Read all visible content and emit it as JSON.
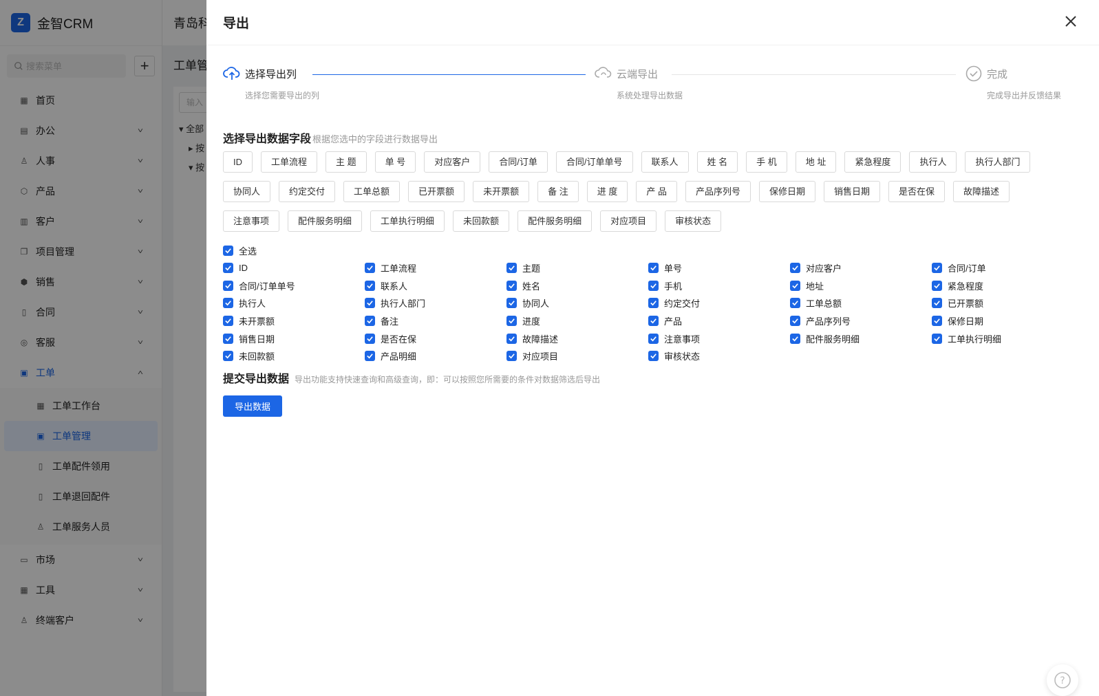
{
  "app": {
    "logo_mark": "Z",
    "name": "金智CRM"
  },
  "sidebar": {
    "search_placeholder": "搜索菜单",
    "add_label": "+",
    "items": [
      {
        "label": "首页",
        "icon": "home-icon"
      },
      {
        "label": "办公",
        "icon": "office-icon"
      },
      {
        "label": "人事",
        "icon": "people-icon"
      },
      {
        "label": "产品",
        "icon": "product-icon"
      },
      {
        "label": "客户",
        "icon": "customer-icon"
      },
      {
        "label": "项目管理",
        "icon": "project-icon"
      },
      {
        "label": "销售",
        "icon": "sales-icon"
      },
      {
        "label": "合同",
        "icon": "contract-icon"
      },
      {
        "label": "客服",
        "icon": "service-icon"
      },
      {
        "label": "工单",
        "icon": "workorder-icon"
      },
      {
        "label": "市场",
        "icon": "market-icon"
      },
      {
        "label": "工具",
        "icon": "tools-icon"
      },
      {
        "label": "终端客户",
        "icon": "terminal-customer-icon"
      }
    ],
    "sub_items": [
      {
        "label": "工单工作台"
      },
      {
        "label": "工单管理"
      },
      {
        "label": "工单配件领用"
      },
      {
        "label": "工单退回配件"
      },
      {
        "label": "工单服务人员"
      }
    ]
  },
  "background": {
    "company": "青岛科",
    "page_title": "工单管",
    "tree_placeholder": "输入",
    "tree_nodes": [
      "全部",
      "按",
      "按"
    ]
  },
  "drawer": {
    "title": "导出",
    "steps": [
      {
        "title": "选择导出列",
        "desc": "选择您需要导出的列"
      },
      {
        "title": "云端导出",
        "desc": "系统处理导出数据"
      },
      {
        "title": "完成",
        "desc": "完成导出并反馈结果"
      }
    ],
    "fields_section": {
      "title": "选择导出数据字段",
      "hint": "根据您选中的字段进行数据导出"
    },
    "tags": [
      "ID",
      "工单流程",
      "主 题",
      "单 号",
      "对应客户",
      "合同/订单",
      "合同/订单单号",
      "联系人",
      "姓 名",
      "手 机",
      "地 址",
      "紧急程度",
      "执行人",
      "执行人部门",
      "协同人",
      "约定交付",
      "工单总额",
      "已开票额",
      "未开票额",
      "备 注",
      "进 度",
      "产 品",
      "产品序列号",
      "保修日期",
      "销售日期",
      "是否在保",
      "故障描述",
      "注意事项",
      "配件服务明细",
      "工单执行明细",
      "未回款额",
      "配件服务明细",
      "对应项目",
      "审核状态"
    ],
    "check_all_label": "全选",
    "checkboxes": [
      "ID",
      "工单流程",
      "主题",
      "单号",
      "对应客户",
      "合同/订单",
      "合同/订单单号",
      "联系人",
      "姓名",
      "手机",
      "地址",
      "紧急程度",
      "执行人",
      "执行人部门",
      "协同人",
      "约定交付",
      "工单总额",
      "已开票额",
      "未开票额",
      "备注",
      "进度",
      "产品",
      "产品序列号",
      "保修日期",
      "销售日期",
      "是否在保",
      "故障描述",
      "注意事项",
      "配件服务明细",
      "工单执行明细",
      "未回款额",
      "产品明细",
      "对应项目",
      "审核状态"
    ],
    "submit_section": {
      "title": "提交导出数据",
      "hint": "导出功能支持快速查询和高级查询，即：可以按照您所需要的条件对数据筛选后导出"
    },
    "export_button": "导出数据"
  },
  "colors": {
    "accent": "#1c66e5",
    "mask": "rgba(0,0,0,0.45)"
  }
}
